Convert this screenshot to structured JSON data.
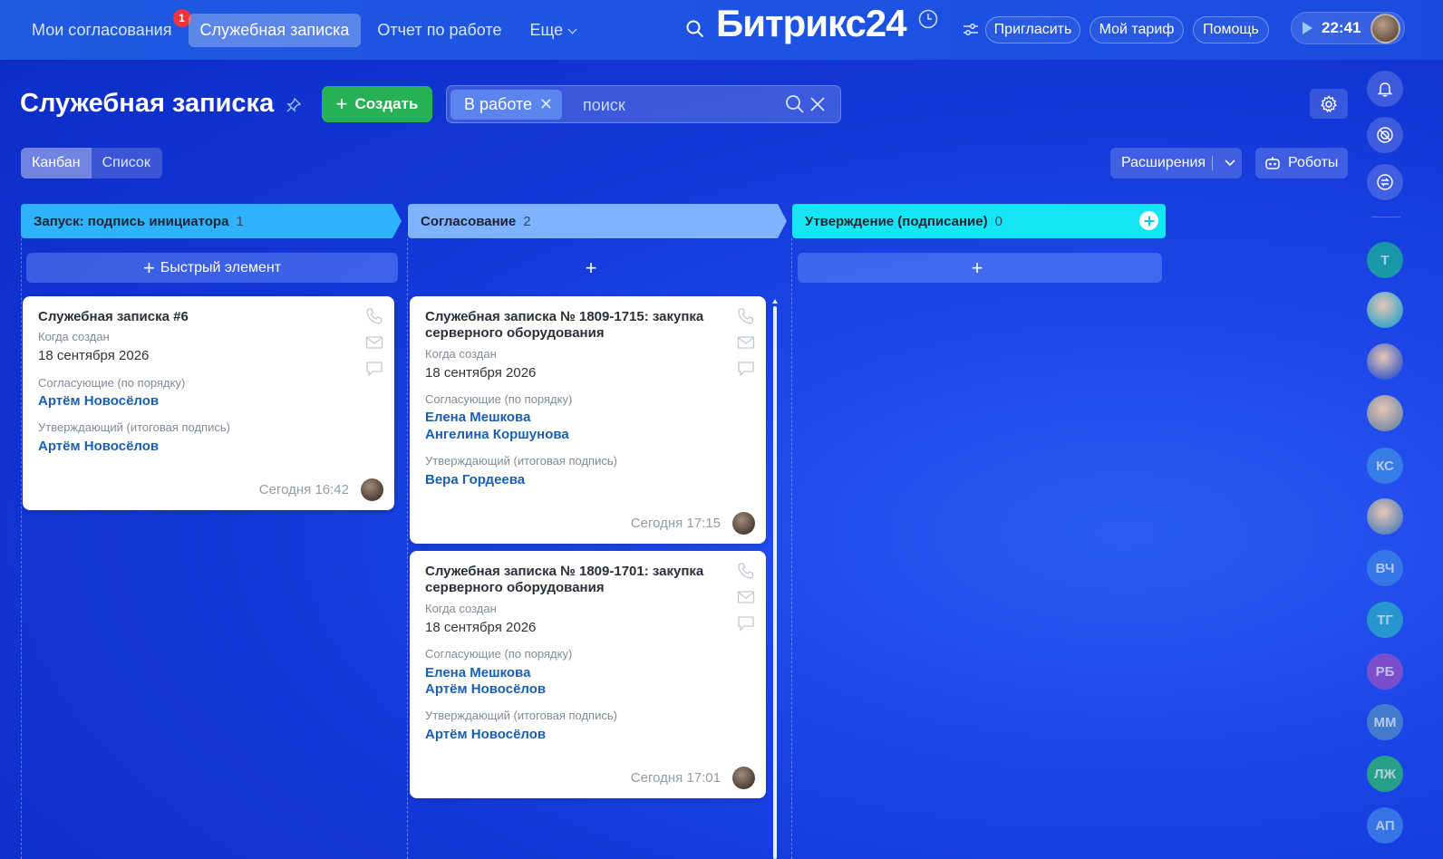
{
  "topbar": {
    "nav": [
      {
        "label": "Мои согласования",
        "badge": "1"
      },
      {
        "label": "Служебная записка",
        "active": true
      },
      {
        "label": "Отчет по работе"
      },
      {
        "label": "Еще"
      }
    ],
    "logo": "Битрикс24",
    "buttons": {
      "invite": "Пригласить",
      "tariff": "Мой тариф",
      "help": "Помощь"
    },
    "time": "22:41"
  },
  "page": {
    "title": "Служебная записка",
    "create_label": "Создать",
    "filter_chip": "В работе",
    "search_placeholder": "поиск"
  },
  "views": {
    "kanban": "Канбан",
    "list": "Список"
  },
  "toolbar": {
    "extensions": "Расширения",
    "robots": "Роботы"
  },
  "quick_add": "Быстрый элемент",
  "columns": [
    {
      "title": "Запуск: подпись инициатора",
      "count": "1",
      "color": "#2eb4ff",
      "cards": [
        {
          "title": "Служебная записка #6",
          "created_label": "Когда создан",
          "created": "18 сентября 2026",
          "approvers_label": "Согласующие (по порядку)",
          "approvers": [
            "Артём Новосёлов"
          ],
          "signer_label": "Утверждающий (итоговая подпись)",
          "signer": "Артём Новосёлов",
          "footer": "Сегодня 16:42"
        }
      ]
    },
    {
      "title": "Согласование",
      "count": "2",
      "color": "#7fb2ff",
      "cards": [
        {
          "title": "Служебная записка № 1809-1715: закупка серверного оборудования",
          "created_label": "Когда создан",
          "created": "18 сентября 2026",
          "approvers_label": "Согласующие (по порядку)",
          "approvers": [
            "Елена Мешкова",
            "Ангелина Коршунова"
          ],
          "signer_label": "Утверждающий (итоговая подпись)",
          "signer": "Вера Гордеева",
          "footer": "Сегодня 17:15"
        },
        {
          "title": "Служебная записка № 1809-1701: закупка серверного оборудования",
          "created_label": "Когда создан",
          "created": "18 сентября 2026",
          "approvers_label": "Согласующие (по порядку)",
          "approvers": [
            "Елена Мешкова",
            "Артём Новосёлов"
          ],
          "signer_label": "Утверждающий (итоговая подпись)",
          "signer": "Артём Новосёлов",
          "footer": "Сегодня 17:01"
        }
      ]
    },
    {
      "title": "Утверждение (подписание)",
      "count": "0",
      "color": "#13e6f4",
      "cards": []
    }
  ],
  "sidebar_avatars": [
    {
      "initials": "Т",
      "color": "#1aa7a0"
    },
    {
      "initials": "",
      "color": "#3aa3c9"
    },
    {
      "initials": "",
      "color": "#3f5ec9"
    },
    {
      "initials": "",
      "color": "#7a8ba8"
    },
    {
      "initials": "КС",
      "color": "#3a86e6"
    },
    {
      "initials": "",
      "color": "#5c84b8"
    },
    {
      "initials": "ВЧ",
      "color": "#3a7ee8"
    },
    {
      "initials": "ТГ",
      "color": "#2aa3c9"
    },
    {
      "initials": "РБ",
      "color": "#8a4fc8"
    },
    {
      "initials": "ММ",
      "color": "#4a84c9"
    },
    {
      "initials": "ЛЖ",
      "color": "#2bb07a"
    },
    {
      "initials": "АП",
      "color": "#3a7ee8"
    }
  ]
}
